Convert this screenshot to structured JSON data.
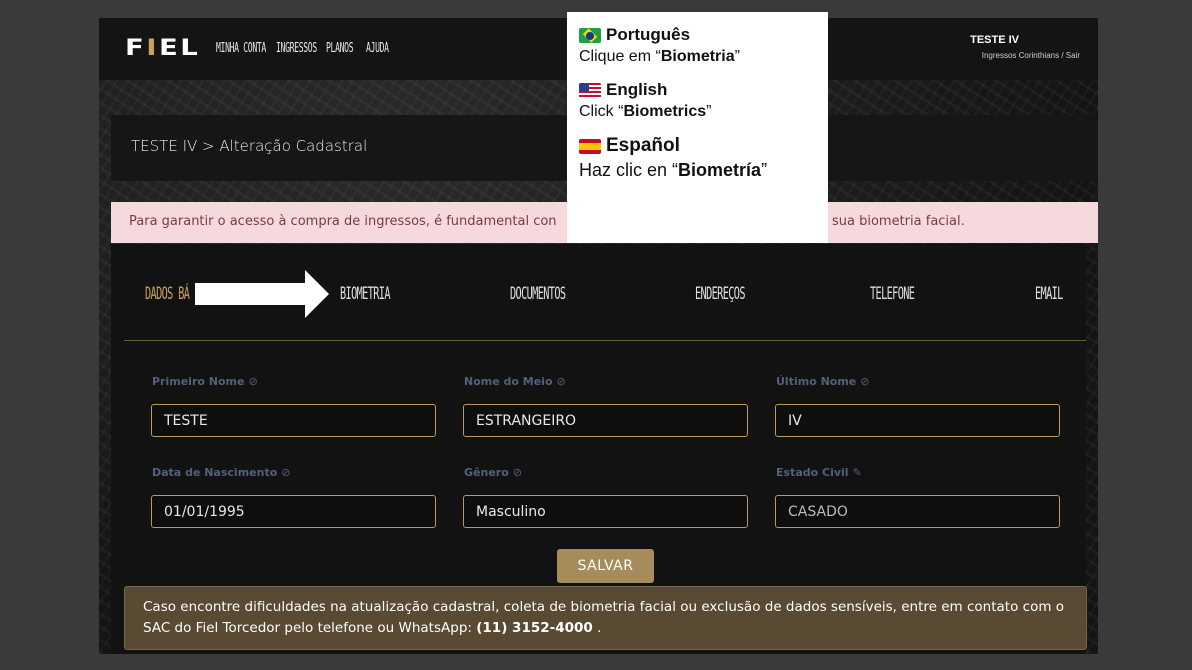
{
  "nav": {
    "logo_left": "F",
    "logo_mid": "I",
    "logo_right": "EL",
    "links": [
      "MINHA CONTA",
      "INGRESSOS",
      "PLANOS",
      "AJUDA"
    ],
    "user_name": "TESTE IV",
    "user_sub": "Ingressos Corinthians / Sair"
  },
  "breadcrumb": "TESTE IV > Alteração Cadastral",
  "alert": {
    "text_start": "Para garantir o acesso à compra de ingressos, é fundamental con",
    "text_end": "sua biometria facial."
  },
  "tabs": [
    "DADOS BÁ",
    "BIOMETRIA",
    "DOCUMENTOS",
    "ENDEREÇOS",
    "TELEFONE",
    "EMAIL"
  ],
  "form": {
    "first_name_label": "Primeiro Nome",
    "first_name_value": "TESTE",
    "middle_name_label": "Nome do Meio",
    "middle_name_value": "ESTRANGEIRO",
    "last_name_label": "Último Nome",
    "last_name_value": "IV",
    "birth_label": "Data de Nascimento",
    "birth_value": "01/01/1995",
    "gender_label": "Gênero",
    "gender_value": "Masculino",
    "civil_label": "Estado Civil",
    "civil_value": "CASADO",
    "save_label": "SALVAR",
    "locked_icon": "⊘",
    "edit_icon": "✎"
  },
  "info": {
    "text": "Caso encontre dificuldades na atualização cadastral, coleta de biometria facial ou exclusão de dados sensíveis, entre em contato com o SAC do Fiel Torcedor pelo telefone ou WhatsApp: ",
    "phone": "(11) 3152-4000",
    "end": " ."
  },
  "tooltip": {
    "pt_head": "Português",
    "pt_pre": "Clique em “",
    "pt_bold": "Biometria",
    "pt_post": "”",
    "en_head": "English",
    "en_pre": "Click “",
    "en_bold": "Biometrics",
    "en_post": "”",
    "es_head": "Español",
    "es_pre": "Haz clic en “",
    "es_bold": "Biometría",
    "es_post": "”"
  },
  "colors": {
    "accent_gold": "#c9a45c",
    "alert_bg": "#f6d9dd",
    "info_bg": "#584a33"
  }
}
